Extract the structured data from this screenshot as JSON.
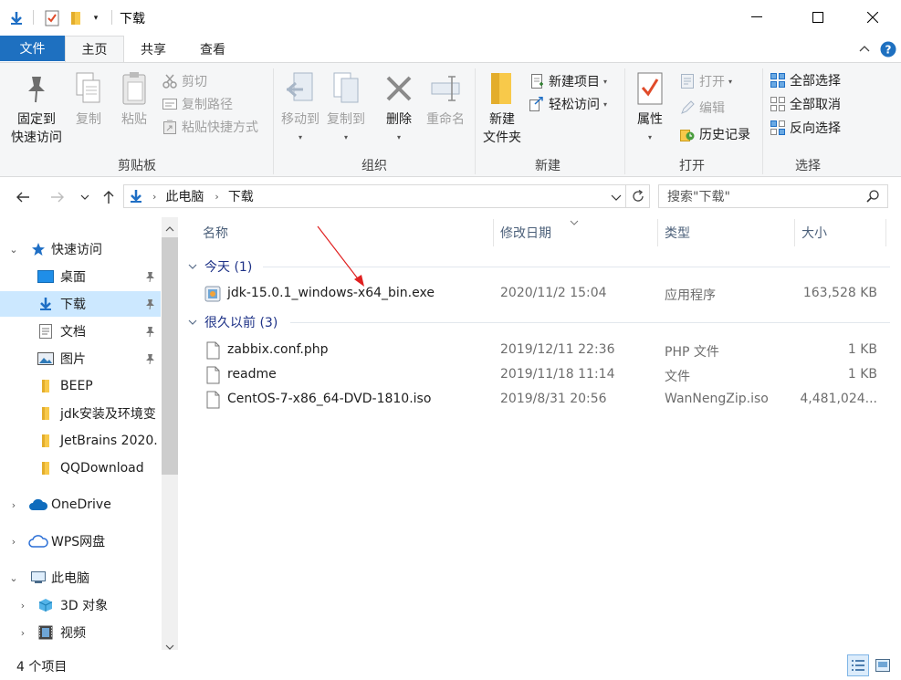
{
  "window": {
    "title": "下载"
  },
  "ribbon_tabs": {
    "file": "文件",
    "home": "主页",
    "share": "共享",
    "view": "查看"
  },
  "ribbon": {
    "clipboard": {
      "pin_quick_access": [
        "固定到",
        "快速访问"
      ],
      "copy": "复制",
      "paste": "粘贴",
      "cut": "剪切",
      "copy_path": "复制路径",
      "paste_shortcut": "粘贴快捷方式",
      "label": "剪贴板"
    },
    "organize": {
      "move_to": "移动到",
      "copy_to": "复制到",
      "delete": "删除",
      "rename": "重命名",
      "label": "组织"
    },
    "new": {
      "new_folder": [
        "新建",
        "文件夹"
      ],
      "new_item": "新建项目",
      "easy_access": "轻松访问",
      "label": "新建"
    },
    "open": {
      "properties": "属性",
      "open": "打开",
      "edit": "编辑",
      "history": "历史记录",
      "label": "打开"
    },
    "select": {
      "select_all": "全部选择",
      "select_none": "全部取消",
      "invert": "反向选择",
      "label": "选择"
    }
  },
  "address": {
    "crumbs": [
      "此电脑",
      "下载"
    ],
    "search_placeholder": "搜索\"下载\""
  },
  "nav": {
    "quick_access": "快速访问",
    "desktop": "桌面",
    "downloads": "下载",
    "documents": "文档",
    "pictures": "图片",
    "beep": "BEEP",
    "jdk": "jdk安装及环境变",
    "jetbrains": "JetBrains 2020.",
    "qqdownload": "QQDownload",
    "onedrive": "OneDrive",
    "wps": "WPS网盘",
    "this_pc": "此电脑",
    "objects3d": "3D 对象",
    "videos": "视频"
  },
  "columns": {
    "name": "名称",
    "date": "修改日期",
    "type": "类型",
    "size": "大小"
  },
  "groups": [
    {
      "label": "今天 (1)",
      "files": [
        {
          "name": "jdk-15.0.1_windows-x64_bin.exe",
          "date": "2020/11/2 15:04",
          "type": "应用程序",
          "size": "163,528 KB",
          "icon": "installer-icon"
        }
      ]
    },
    {
      "label": "很久以前 (3)",
      "files": [
        {
          "name": "zabbix.conf.php",
          "date": "2019/12/11 22:36",
          "type": "PHP 文件",
          "size": "1 KB",
          "icon": "file-icon"
        },
        {
          "name": "readme",
          "date": "2019/11/18 11:14",
          "type": "文件",
          "size": "1 KB",
          "icon": "file-icon"
        },
        {
          "name": "CentOS-7-x86_64-DVD-1810.iso",
          "date": "2019/8/31 20:56",
          "type": "WanNengZip.iso",
          "size": "4,481,024...",
          "icon": "file-icon"
        }
      ]
    }
  ],
  "status": {
    "count": "4 个项目"
  },
  "colors": {
    "accent": "#1e70c0",
    "selected": "#cce8ff",
    "folder": "#f8c94a",
    "group_text": "#1e3287"
  }
}
